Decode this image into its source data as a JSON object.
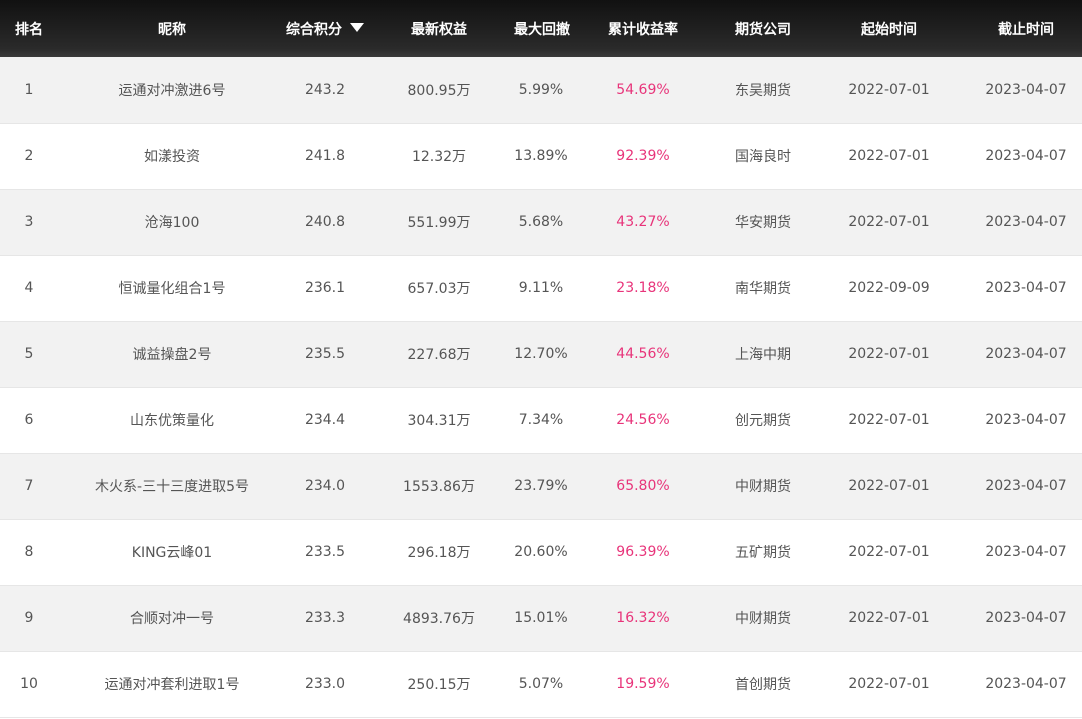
{
  "header": {
    "rank": "排名",
    "nickname": "昵称",
    "score": "综合积分",
    "latest_equity": "最新权益",
    "max_drawdown": "最大回撤",
    "cumulative_return": "累计收益率",
    "futures_company": "期货公司",
    "start_time": "起始时间",
    "end_time": "截止时间"
  },
  "rows": [
    {
      "rank": "1",
      "name": "运通对冲激进6号",
      "score": "243.2",
      "equity": "800.95万",
      "drawdown": "5.99%",
      "return": "54.69%",
      "company": "东吴期货",
      "start": "2022-07-01",
      "end": "2023-04-07"
    },
    {
      "rank": "2",
      "name": "如漾投资",
      "score": "241.8",
      "equity": "12.32万",
      "drawdown": "13.89%",
      "return": "92.39%",
      "company": "国海良时",
      "start": "2022-07-01",
      "end": "2023-04-07"
    },
    {
      "rank": "3",
      "name": "沧海100",
      "score": "240.8",
      "equity": "551.99万",
      "drawdown": "5.68%",
      "return": "43.27%",
      "company": "华安期货",
      "start": "2022-07-01",
      "end": "2023-04-07"
    },
    {
      "rank": "4",
      "name": "恒诚量化组合1号",
      "score": "236.1",
      "equity": "657.03万",
      "drawdown": "9.11%",
      "return": "23.18%",
      "company": "南华期货",
      "start": "2022-09-09",
      "end": "2023-04-07"
    },
    {
      "rank": "5",
      "name": "诚益操盘2号",
      "score": "235.5",
      "equity": "227.68万",
      "drawdown": "12.70%",
      "return": "44.56%",
      "company": "上海中期",
      "start": "2022-07-01",
      "end": "2023-04-07"
    },
    {
      "rank": "6",
      "name": "山东优策量化",
      "score": "234.4",
      "equity": "304.31万",
      "drawdown": "7.34%",
      "return": "24.56%",
      "company": "创元期货",
      "start": "2022-07-01",
      "end": "2023-04-07"
    },
    {
      "rank": "7",
      "name": "木火系-三十三度进取5号",
      "score": "234.0",
      "equity": "1553.86万",
      "drawdown": "23.79%",
      "return": "65.80%",
      "company": "中财期货",
      "start": "2022-07-01",
      "end": "2023-04-07"
    },
    {
      "rank": "8",
      "name": "KING云峰01",
      "score": "233.5",
      "equity": "296.18万",
      "drawdown": "20.60%",
      "return": "96.39%",
      "company": "五矿期货",
      "start": "2022-07-01",
      "end": "2023-04-07"
    },
    {
      "rank": "9",
      "name": "合顺对冲一号",
      "score": "233.3",
      "equity": "4893.76万",
      "drawdown": "15.01%",
      "return": "16.32%",
      "company": "中财期货",
      "start": "2022-07-01",
      "end": "2023-04-07"
    },
    {
      "rank": "10",
      "name": "运通对冲套利进取1号",
      "score": "233.0",
      "equity": "250.15万",
      "drawdown": "5.07%",
      "return": "19.59%",
      "company": "首创期货",
      "start": "2022-07-01",
      "end": "2023-04-07"
    }
  ],
  "colors": {
    "header_bg": "#1a1a1a",
    "row_alt": "#f2f2f2",
    "return_color": "#e8347a",
    "text": "#555555"
  },
  "icons": {
    "sort": "sort-desc-icon"
  }
}
